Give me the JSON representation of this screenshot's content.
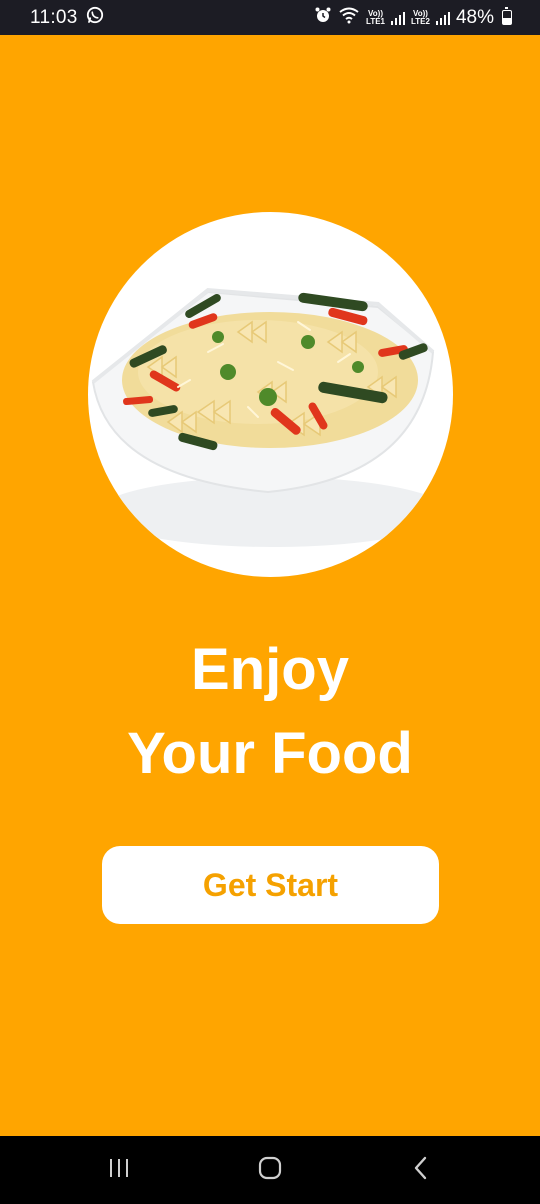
{
  "status_bar": {
    "time": "11:03",
    "whatsapp_icon": "whatsapp-icon",
    "alarm_icon": "alarm-icon",
    "wifi_icon": "wifi-icon",
    "sim1_label_top": "Vo))",
    "sim1_label_bottom": "LTE1",
    "sim2_label_top": "Vo))",
    "sim2_label_bottom": "LTE2",
    "battery": "48%"
  },
  "main": {
    "headline_line1": "Enjoy",
    "headline_line2": "Your Food",
    "cta_label": "Get Start",
    "image_subject": "pasta-bowl"
  },
  "nav": {
    "recents_icon": "recents-icon",
    "home_icon": "home-icon",
    "back_icon": "back-icon"
  },
  "colors": {
    "background": "#FFA500",
    "button_bg": "#FFFFFF",
    "button_text": "#F5A100",
    "headline": "#FFFFFF",
    "status_bar": "#1C1C24",
    "nav_bar": "#000000"
  }
}
